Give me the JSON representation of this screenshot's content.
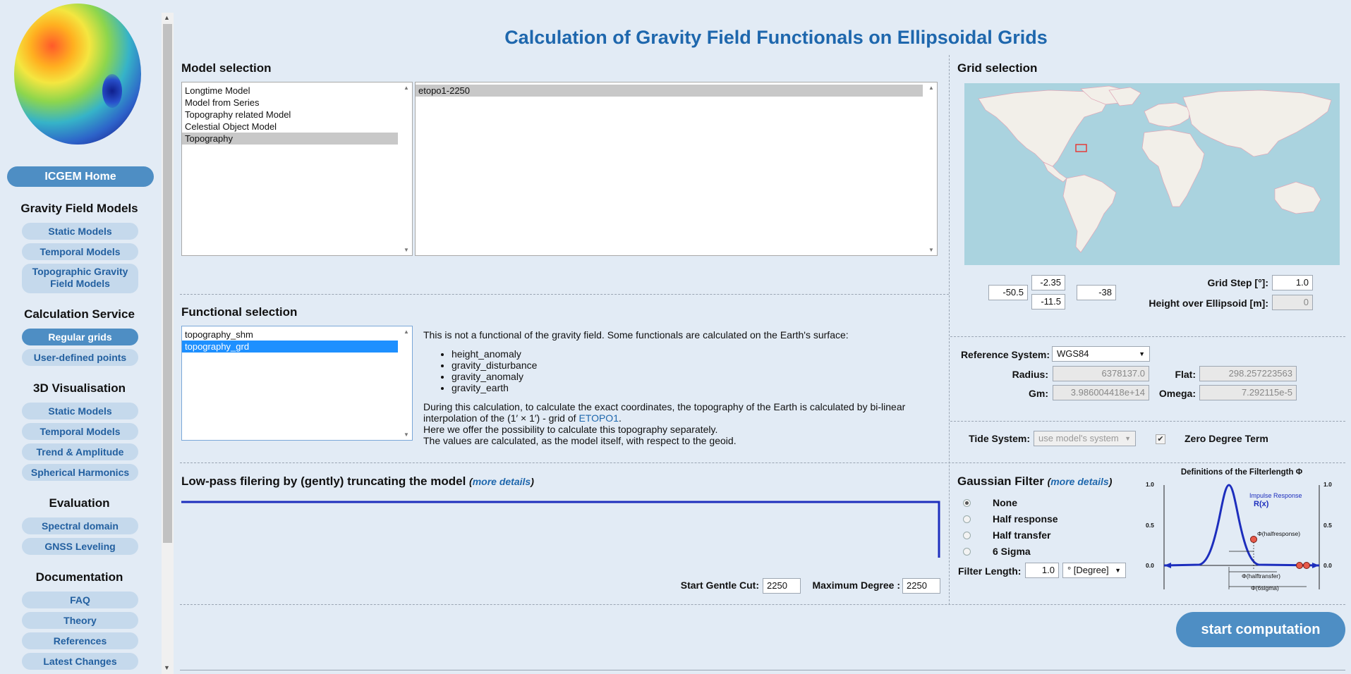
{
  "page_title": "Calculation of Gravity Field Functionals on Ellipsoidal Grids",
  "sidebar": {
    "home": "ICGEM Home",
    "sections": [
      {
        "title": "Gravity Field Models",
        "items": [
          "Static Models",
          "Temporal Models",
          "Topographic Gravity Field Models"
        ]
      },
      {
        "title": "Calculation Service",
        "items": [
          "Regular grids",
          "User-defined points"
        ]
      },
      {
        "title": "3D Visualisation",
        "items": [
          "Static Models",
          "Temporal Models",
          "Trend & Amplitude",
          "Spherical Harmonics"
        ]
      },
      {
        "title": "Evaluation",
        "items": [
          "Spectral domain",
          "GNSS Leveling"
        ]
      },
      {
        "title": "Documentation",
        "items": [
          "FAQ",
          "Theory",
          "References",
          "Latest Changes"
        ]
      }
    ],
    "active_item": "Regular grids"
  },
  "model_selection": {
    "title": "Model selection",
    "categories": [
      "Longtime Model",
      "Model from Series",
      "Topography related Model",
      "Celestial Object Model",
      "Topography"
    ],
    "selected_category": "Topography",
    "models": [
      "etopo1-2250"
    ],
    "selected_model": "etopo1-2250"
  },
  "functional_selection": {
    "title": "Functional selection",
    "items": [
      "topography_shm",
      "topography_grd"
    ],
    "selected": "topography_grd",
    "desc_intro": "This is not a functional of the gravity field. Some functionals are calculated on the Earth's surface:",
    "desc_list": [
      "height_anomaly",
      "gravity_disturbance",
      "gravity_anomaly",
      "gravity_earth"
    ],
    "desc_p1a": "During this calculation, to calculate the exact coordinates, the topography of the Earth is calculated by bi-linear",
    "desc_p1b": "interpolation of the (1′ × 1′) - grid of",
    "desc_link": "ETOPO1",
    "desc_p1c": ".",
    "desc_p2": "Here we offer the possibility to calculate this topography separately.",
    "desc_p3": "The values are calculated, as the model itself, with respect to the geoid."
  },
  "grid_selection": {
    "title": "Grid selection",
    "north": "-2.35",
    "south": "-11.5",
    "west": "-50.5",
    "east": "-38",
    "grid_step_label": "Grid Step [°]:",
    "grid_step": "1.0",
    "height_label": "Height over Ellipsoid [m]:",
    "height": "0"
  },
  "reference": {
    "system_label": "Reference System:",
    "system": "WGS84",
    "radius_label": "Radius:",
    "radius": "6378137.0",
    "flat_label": "Flat:",
    "flat": "298.257223563",
    "gm_label": "Gm:",
    "gm": "3.986004418e+14",
    "omega_label": "Omega:",
    "omega": "7.292115e-5",
    "tide_label": "Tide System:",
    "tide": "use model's system",
    "zero_degree_label": "Zero Degree Term",
    "zero_degree_checked": true
  },
  "lowpass": {
    "title": "Low-pass filering by (gently) truncating the model",
    "more": "more details",
    "start_cut_label": "Start Gentle Cut:",
    "start_cut": "2250",
    "max_degree_label": "Maximum Degree :",
    "max_degree": "2250"
  },
  "gaussian": {
    "title": "Gaussian Filter",
    "more": "more details",
    "options": [
      "None",
      "Half response",
      "Half transfer",
      "6 Sigma"
    ],
    "selected": "None",
    "length_label": "Filter Length:",
    "length": "1.0",
    "unit": "° [Degree]",
    "diagram": {
      "title": "Definitions of the Filterlength Φ",
      "impulse": "Impulse Response",
      "rx": "R(x)",
      "half_response": "Φ(halfresponse)",
      "half_transfer": "Φ(halftransfer)",
      "six_sigma": "Φ(6sigma)",
      "ticks": [
        "1.0",
        "0.5",
        "0.0"
      ]
    }
  },
  "start_button": "start computation",
  "colors": {
    "accent": "#4e8ec4",
    "title": "#1e67ad",
    "background": "#e2ebf5"
  }
}
